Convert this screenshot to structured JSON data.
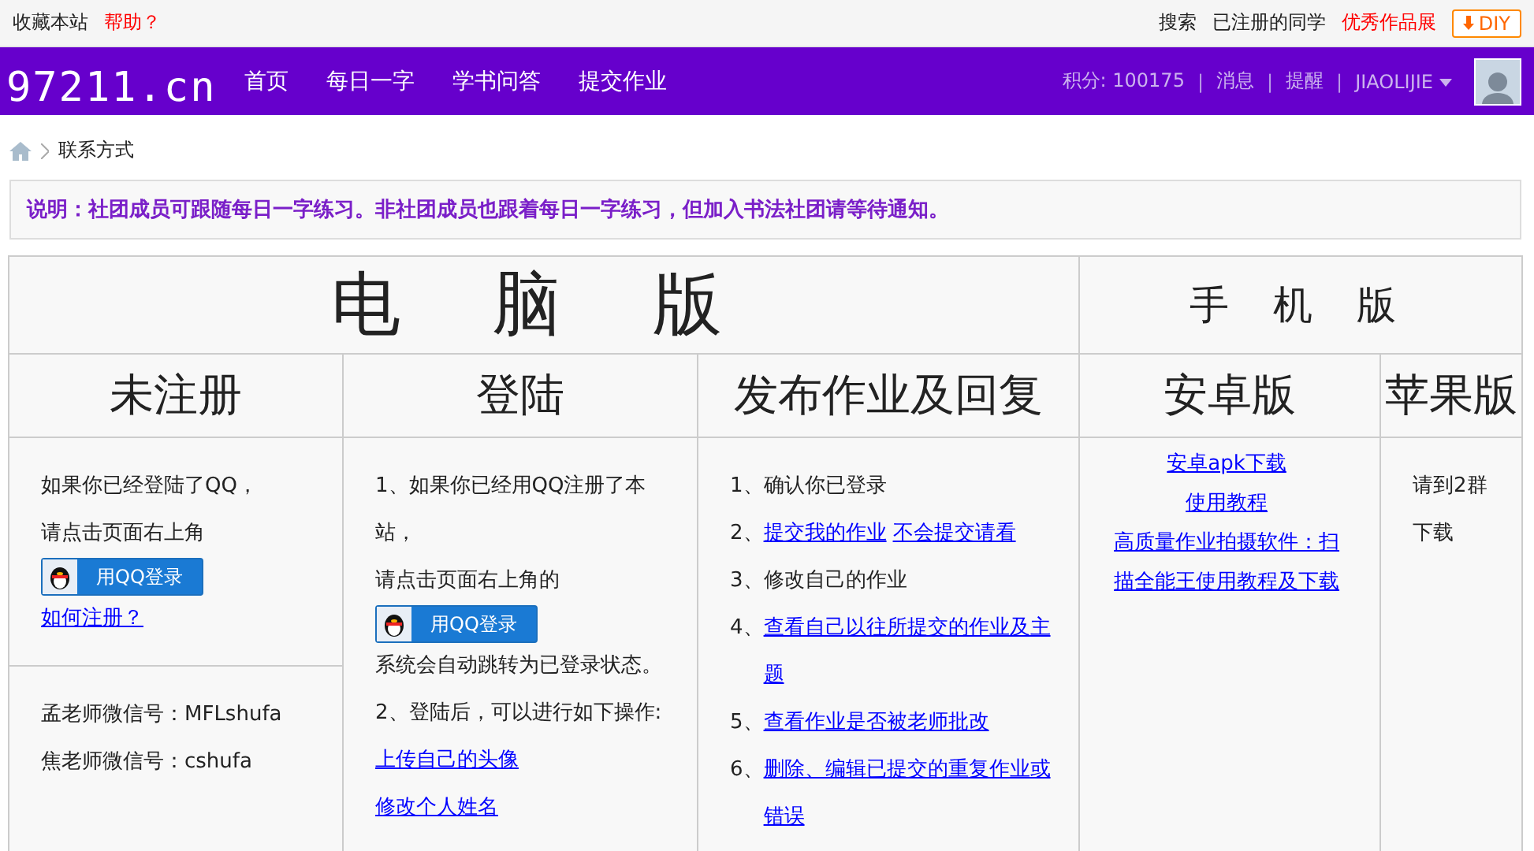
{
  "top_bar": {
    "left": [
      {
        "text": "收藏本站",
        "kind": "plain"
      },
      {
        "text": "帮助？",
        "kind": "alert"
      }
    ],
    "right": [
      {
        "text": "搜索",
        "kind": "plain"
      },
      {
        "text": "已注册的同学",
        "kind": "plain"
      },
      {
        "text": "优秀作品展",
        "kind": "alert"
      }
    ],
    "diy_button": "DIY"
  },
  "nav": {
    "logo": "97211.cn",
    "items": [
      "首页",
      "每日一字",
      "学书问答",
      "提交作业"
    ],
    "score": "积分: 100175",
    "links": [
      "消息",
      "提醒"
    ],
    "separators": [
      "|",
      "|",
      "|"
    ],
    "user": "JIAOLIJIE"
  },
  "breadcrumb": {
    "current": "联系方式"
  },
  "notice": "说明：社团成员可跟随每日一字练习。非社团成员也跟着每日一字练习，但加入书法社团请等待通知。",
  "table": {
    "groups": [
      {
        "title": "电 脑 版"
      },
      {
        "title": "手 机 版"
      }
    ],
    "columns": [
      {
        "heading": "未注册",
        "blocks": [
          [
            [
              {
                "kind": "text",
                "text": "如果你已经登陆了QQ，"
              }
            ],
            [
              {
                "kind": "text",
                "text": "请点击页面右上角"
              }
            ],
            [
              {
                "kind": "qq",
                "text": "用QQ登录"
              }
            ],
            [
              {
                "kind": "link",
                "text": "如何注册？"
              }
            ]
          ],
          [
            [
              {
                "kind": "text",
                "text": "孟老师微信号：MFLshufa"
              }
            ],
            [
              {
                "kind": "text",
                "text": "焦老师微信号：cshufa"
              }
            ]
          ]
        ]
      },
      {
        "heading": "登陆",
        "blocks": [
          [
            [
              {
                "kind": "text",
                "text": "1、如果你已经用QQ注册了本站，"
              }
            ],
            [
              {
                "kind": "text",
                "text": "请点击页面右上角的"
              }
            ],
            [
              {
                "kind": "qq",
                "text": "用QQ登录"
              }
            ],
            [
              {
                "kind": "text",
                "text": "系统会自动跳转为已登录状态。"
              }
            ],
            [
              {
                "kind": "text",
                "text": "2、登陆后，可以进行如下操作:"
              }
            ],
            [
              {
                "kind": "link",
                "text": "上传自己的头像"
              }
            ],
            [
              {
                "kind": "link",
                "text": "修改个人姓名"
              }
            ]
          ]
        ]
      },
      {
        "heading": "发布作业及回复",
        "blocks": [
          [
            [
              {
                "kind": "text",
                "text": "1、确认你已登录"
              }
            ],
            [
              {
                "kind": "text",
                "text": "2、"
              },
              {
                "kind": "link",
                "text": "提交我的作业"
              },
              {
                "kind": "link",
                "text": "不会提交请看"
              }
            ],
            [
              {
                "kind": "text",
                "text": "3、修改自己的作业"
              }
            ],
            [
              {
                "kind": "text",
                "text": "4、"
              },
              {
                "kind": "link",
                "text": "查看自己以往所提交的作业及主题"
              }
            ],
            [
              {
                "kind": "text",
                "text": "5、"
              },
              {
                "kind": "link",
                "text": "查看作业是否被老师批改"
              }
            ],
            [
              {
                "kind": "text",
                "text": "6、"
              },
              {
                "kind": "link",
                "text": "删除、编辑已提交的重复作业或错误"
              }
            ]
          ]
        ]
      },
      {
        "heading": "安卓版",
        "blocks": [
          [
            [
              {
                "kind": "link",
                "text": "安卓apk下载"
              }
            ],
            [
              {
                "kind": "link",
                "text": "使用教程"
              }
            ],
            [
              {
                "kind": "link",
                "text": "高质量作业拍摄软件：扫描全能王使用教程及下载"
              }
            ]
          ]
        ]
      },
      {
        "heading": "苹果版",
        "blocks": [
          [
            [
              {
                "kind": "text",
                "text": "请到2群下载"
              }
            ]
          ]
        ]
      }
    ]
  }
}
